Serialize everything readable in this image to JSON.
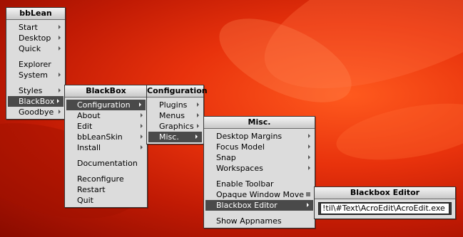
{
  "menus": {
    "bblean": {
      "title": "bbLean",
      "items": [
        {
          "label": "Start",
          "arrow": true
        },
        {
          "label": "Desktop",
          "arrow": true
        },
        {
          "label": "Quick",
          "arrow": true
        },
        {
          "label": "Explorer",
          "arrow": false
        },
        {
          "label": "System",
          "arrow": true
        },
        {
          "label": "Styles",
          "arrow": true
        },
        {
          "label": "BlackBox",
          "arrow": true,
          "active": true
        },
        {
          "label": "Goodbye",
          "arrow": true
        }
      ]
    },
    "blackbox": {
      "title": "BlackBox",
      "items": [
        {
          "label": "Configuration",
          "arrow": true,
          "active": true
        },
        {
          "label": "About",
          "arrow": true
        },
        {
          "label": "Edit",
          "arrow": true
        },
        {
          "label": "bbLeanSkin",
          "arrow": true
        },
        {
          "label": "Install",
          "arrow": true
        },
        {
          "label": "Documentation",
          "arrow": false
        },
        {
          "label": "Reconfigure",
          "arrow": false
        },
        {
          "label": "Restart",
          "arrow": false
        },
        {
          "label": "Quit",
          "arrow": false
        }
      ]
    },
    "configuration": {
      "title": "Configuration",
      "items": [
        {
          "label": "Plugins",
          "arrow": true
        },
        {
          "label": "Menus",
          "arrow": true
        },
        {
          "label": "Graphics",
          "arrow": true
        },
        {
          "label": "Misc.",
          "arrow": true,
          "active": true
        }
      ]
    },
    "misc": {
      "title": "Misc.",
      "items": [
        {
          "label": "Desktop Margins",
          "arrow": true
        },
        {
          "label": "Focus Model",
          "arrow": true
        },
        {
          "label": "Snap",
          "arrow": true
        },
        {
          "label": "Workspaces",
          "arrow": true
        },
        {
          "label": "Enable Toolbar",
          "arrow": false
        },
        {
          "label": "Opaque Window Move",
          "checkbox": true
        },
        {
          "label": "Blackbox Editor",
          "arrow": true,
          "active": true
        },
        {
          "label": "Show Appnames",
          "arrow": false
        }
      ]
    },
    "editor": {
      "title": "Blackbox Editor",
      "value": "!til\\#Text\\AcroEdit\\AcroEdit.exe"
    }
  }
}
